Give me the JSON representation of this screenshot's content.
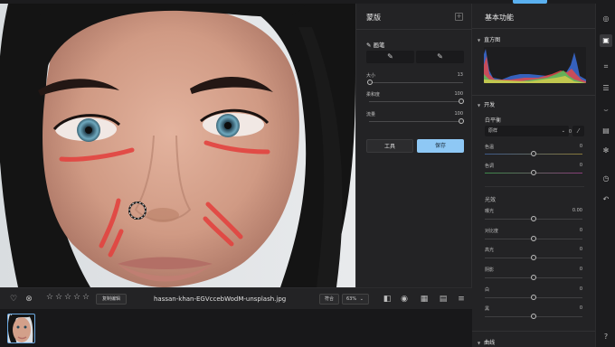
{
  "toolbar": {
    "heart_icon": "heart-icon",
    "reject_icon": "reject-icon",
    "stars": [
      "☆",
      "☆",
      "☆",
      "☆",
      "☆"
    ],
    "edit_label": "复制编辑",
    "filename": "hassan-khan-EGVccebWodM-unsplash.jpg",
    "fit_label": "符合",
    "zoom_label": "63%",
    "zoom_chevron": "⌄"
  },
  "mask_panel": {
    "title": "蒙版",
    "brush_label": "画笔",
    "brush_modes": [
      "✎",
      "✎"
    ],
    "sliders": [
      {
        "label": "大小",
        "value": "13",
        "fraction": 0.0
      },
      {
        "label": "柔和度",
        "value": "100",
        "fraction": 1.0
      },
      {
        "label": "流量",
        "value": "100",
        "fraction": 1.0
      }
    ],
    "cancel_label": "工具",
    "save_label": "保存"
  },
  "basic_panel": {
    "title": "基本功能",
    "histogram_label": "直方图",
    "dev_label": "开发",
    "wb_label": "白平衡",
    "wb_select": "原样",
    "wb_value": "0",
    "wb_sliders": [
      {
        "label": "色温",
        "value": "0",
        "fraction": 0.5
      },
      {
        "label": "色调",
        "value": "0",
        "fraction": 0.5
      }
    ],
    "light_label": "光效",
    "light_sliders": [
      {
        "label": "曝光",
        "value": "0.00",
        "fraction": 0.5
      },
      {
        "label": "对比度",
        "value": "0",
        "fraction": 0.5
      },
      {
        "label": "高光",
        "value": "0",
        "fraction": 0.5
      },
      {
        "label": "阴影",
        "value": "0",
        "fraction": 0.5
      },
      {
        "label": "白",
        "value": "0",
        "fraction": 0.5
      },
      {
        "label": "黑",
        "value": "0",
        "fraction": 0.5
      }
    ],
    "curve_label": "曲线"
  },
  "rail": {
    "icons": [
      "presets-icon",
      "mask-icon",
      "crop-icon",
      "adjust-icon",
      "retouch-icon",
      "layers-icon",
      "effects-icon",
      "history-icon",
      "undo-icon",
      "help-icon"
    ]
  }
}
